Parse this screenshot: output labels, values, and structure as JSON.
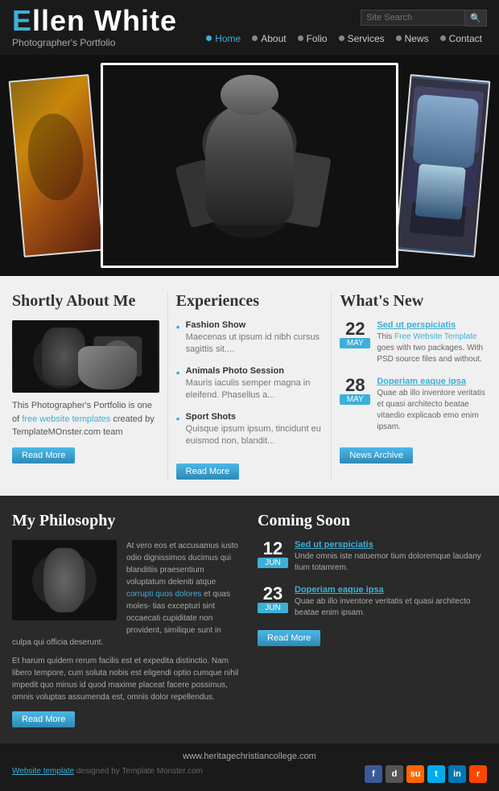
{
  "header": {
    "logo_e": "E",
    "logo_rest": "llen ",
    "logo_white": "White",
    "logo_subtitle": "Photographer's Portfolio",
    "search_placeholder": "Site Search",
    "search_button": "🔍"
  },
  "nav": {
    "items": [
      {
        "label": "Home",
        "active": true
      },
      {
        "label": "About",
        "active": false
      },
      {
        "label": "Folio",
        "active": false
      },
      {
        "label": "Services",
        "active": false
      },
      {
        "label": "News",
        "active": false
      },
      {
        "label": "Contact",
        "active": false
      }
    ]
  },
  "about": {
    "title": "Shortly About Me",
    "text_part1": "This Photographer's Portfolio is one of ",
    "link1_text": "free website templates",
    "text_part2": " created by TemplateMOnster.com team",
    "read_more": "Read More"
  },
  "experiences": {
    "title": "Experiences",
    "items": [
      {
        "title": "Fashion Show",
        "text": "Maecenas ut ipsum id nibh cursus sagittis sit...."
      },
      {
        "title": "Animals Photo Session",
        "text": "Mauris iaculis semper magna in eleifend. Phasellus a..."
      },
      {
        "title": "Sport Shots",
        "text": "Quisque ipsum ipsum, tincidunt eu euismod non, blandit..."
      }
    ],
    "read_more": "Read More"
  },
  "whats_new": {
    "title": "What's New",
    "items": [
      {
        "day": "22",
        "month": "may",
        "title": "Sed ut perspiciatis",
        "text": "This Free Website Template goes with two packages. With PSD source files and without."
      },
      {
        "day": "28",
        "month": "may",
        "title": "Doperiam eaque ipsa",
        "text": "Quae ab illo inventore veritatis et quasi architecto beatae vitaedio explicaob emo enim ipsam."
      }
    ],
    "archive_button": "News Archive"
  },
  "philosophy": {
    "title": "My Philosophy",
    "inline_text": "At vero eos et accusamus iusto odio dignissimos ducimus qui blanditiis praesentium voluptatum deleniti atque corrupti quos dolores et quas moles- tias excepturi sint occaecati cupiditate non provident, similique sunt in culpa qui officia deserunt.",
    "full_text": "Et harum quidem rerum facilis est et expedita distinctio. Nam libero tempore, cum soluta nobis est eligendi optio cumque nihil impedit quo minus id quod maxime placeat facere possimus, omnis voluptas assumenda est, omnis dolor repellendus.",
    "inline_link": "corrupti quos dolores",
    "read_more": "Read More"
  },
  "coming_soon": {
    "title": "Coming Soon",
    "items": [
      {
        "day": "12",
        "month": "jun",
        "title": "Sed ut perspiciatis",
        "text": "Unde omnis iste natuemor tium doloremque laudany tium totamrem."
      },
      {
        "day": "23",
        "month": "jun",
        "title": "Doperiam eaque ipsa",
        "text": "Quae ab illo inventore veritatis et quasi architecto beatae enim ipsam."
      }
    ],
    "read_more": "Read More"
  },
  "footer": {
    "url": "www.heritagechristiancollege.com",
    "credit_text": "Website template designed by Template Monster.com",
    "credit_link": "Website template"
  },
  "social": {
    "icons": [
      {
        "name": "facebook",
        "label": "f",
        "class": "si-fb"
      },
      {
        "name": "delicious",
        "label": "d",
        "class": "si-de"
      },
      {
        "name": "stumbleupon",
        "label": "su",
        "class": "si-su"
      },
      {
        "name": "twitter",
        "label": "t",
        "class": "si-tw"
      },
      {
        "name": "linkedin",
        "label": "in",
        "class": "si-li"
      },
      {
        "name": "reddit",
        "label": "r",
        "class": "si-rd"
      }
    ]
  }
}
